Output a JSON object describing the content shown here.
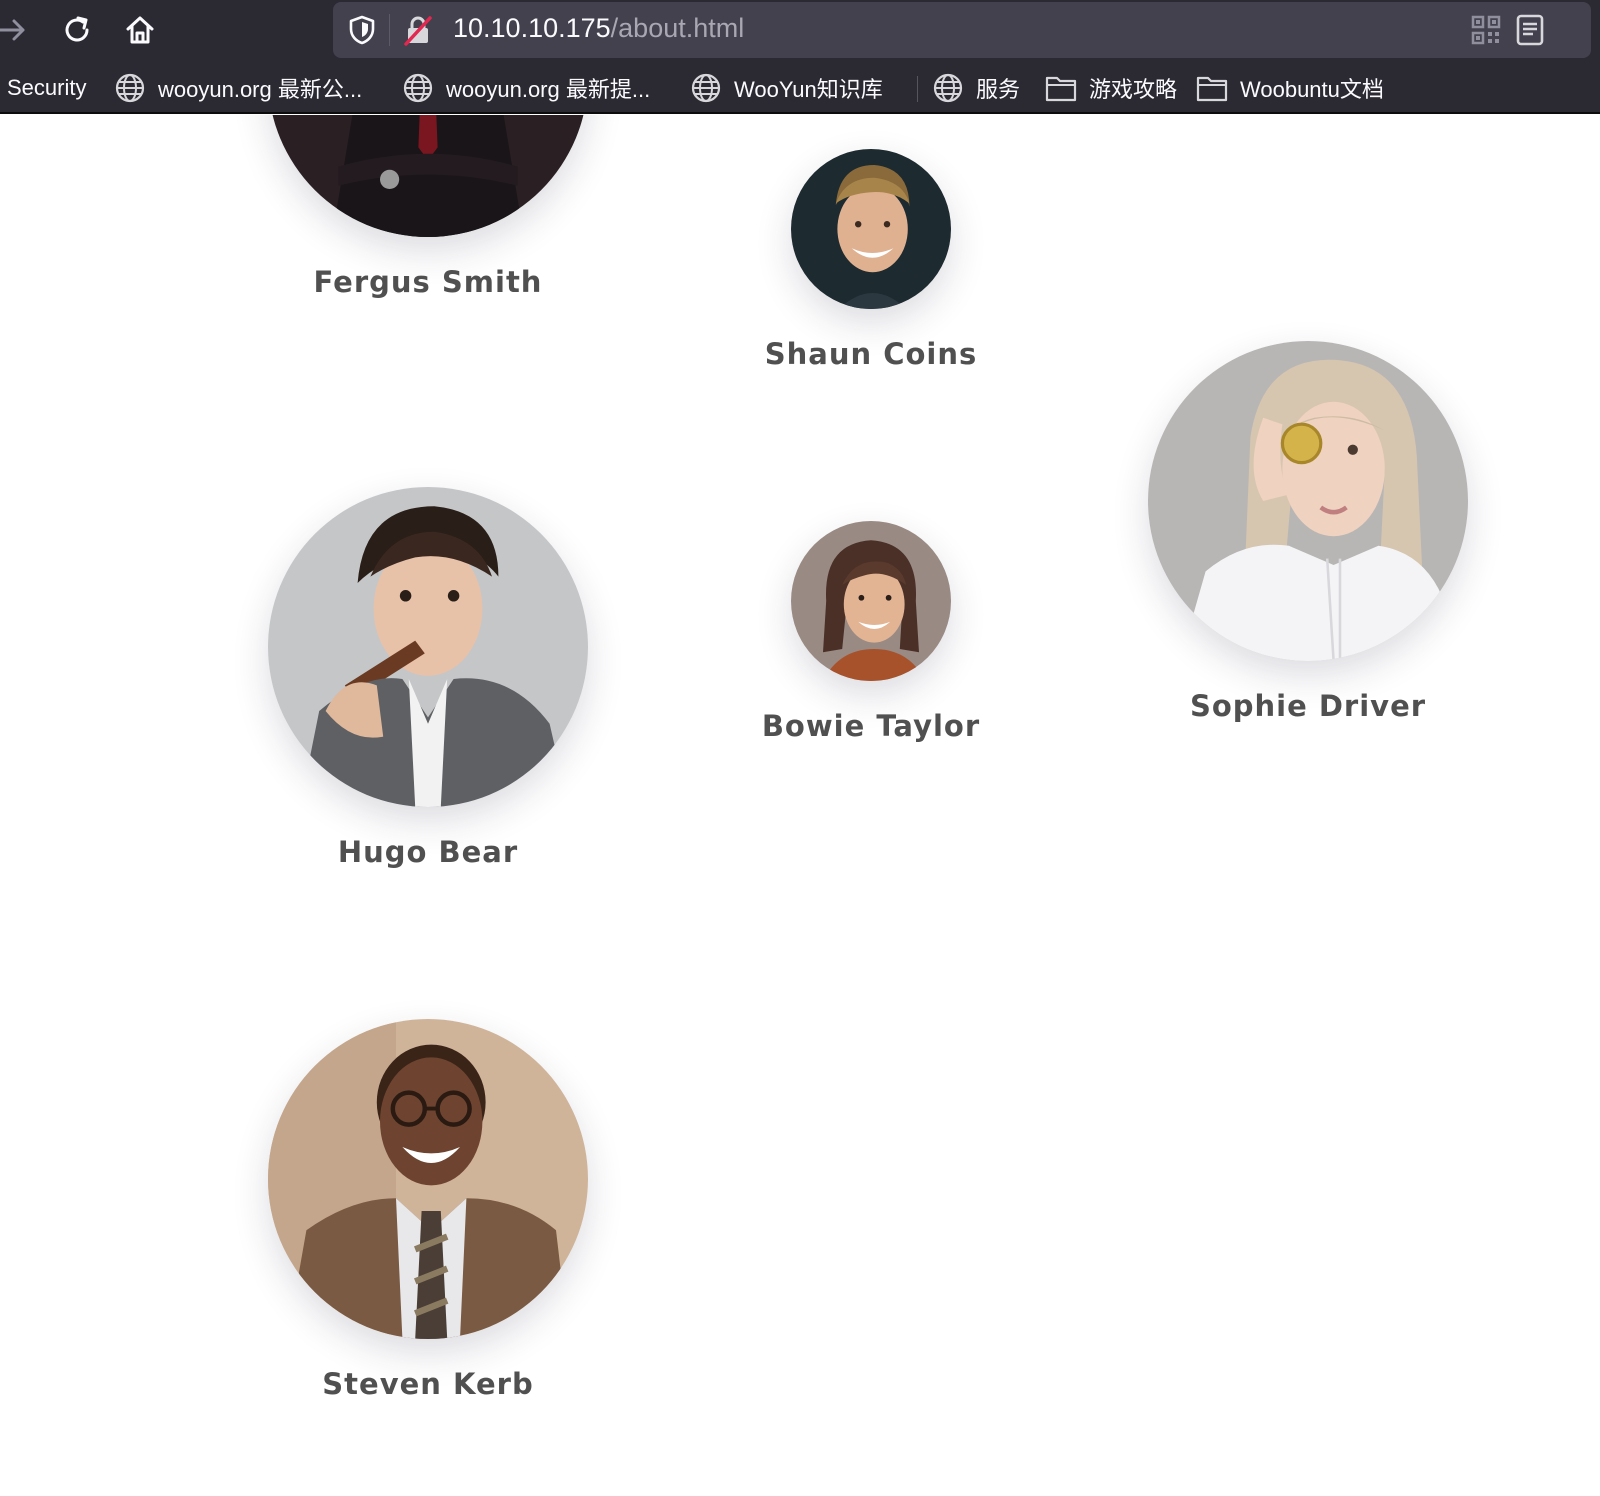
{
  "browser": {
    "url_host": "10.10.10.175",
    "url_path": "/about.html",
    "bookmarks": [
      {
        "label": "Security",
        "icon": "none"
      },
      {
        "label": "wooyun.org 最新公...",
        "icon": "globe-icon"
      },
      {
        "label": "wooyun.org 最新提...",
        "icon": "globe-icon"
      },
      {
        "label": "WooYun知识库",
        "icon": "globe-icon"
      },
      {
        "label": "服务",
        "icon": "globe-icon"
      },
      {
        "label": "游戏攻略",
        "icon": "folder-icon"
      },
      {
        "label": "Woobuntu文档",
        "icon": "folder-icon"
      }
    ]
  },
  "team": {
    "members": [
      {
        "name": "Fergus Smith"
      },
      {
        "name": "Shaun Coins"
      },
      {
        "name": "Sophie Driver"
      },
      {
        "name": "Hugo Bear"
      },
      {
        "name": "Bowie Taylor"
      },
      {
        "name": "Steven Kerb"
      }
    ]
  },
  "colors": {
    "chrome_bg": "#2b2a33",
    "urlbar_bg": "#42414d",
    "name_text": "#505050"
  }
}
